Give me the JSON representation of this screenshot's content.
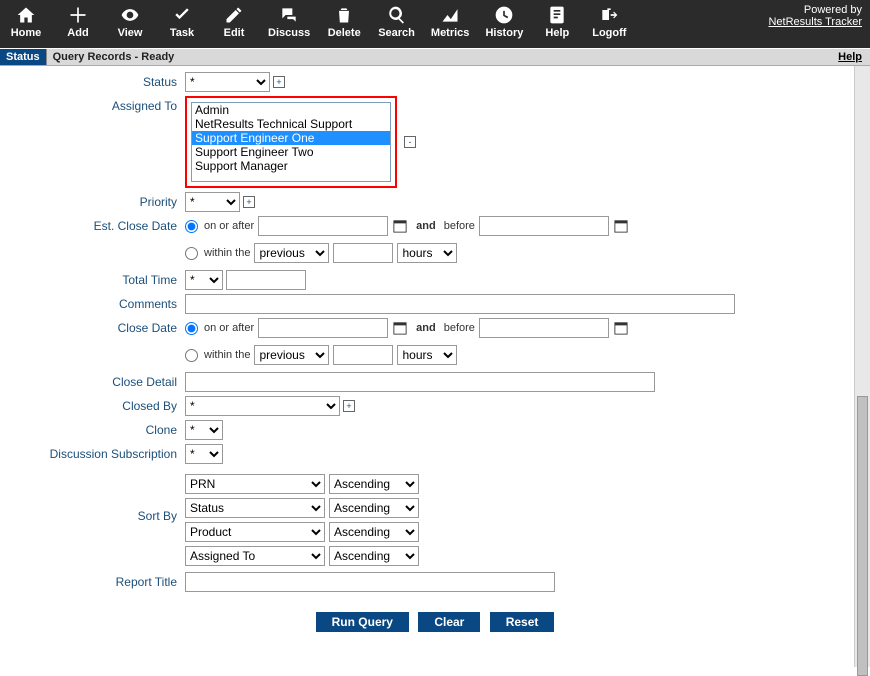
{
  "powered": {
    "text": "Powered by",
    "link": "NetResults Tracker"
  },
  "toolbar": [
    {
      "name": "home",
      "label": "Home"
    },
    {
      "name": "add",
      "label": "Add"
    },
    {
      "name": "view",
      "label": "View"
    },
    {
      "name": "task",
      "label": "Task"
    },
    {
      "name": "edit",
      "label": "Edit"
    },
    {
      "name": "discuss",
      "label": "Discuss"
    },
    {
      "name": "delete",
      "label": "Delete"
    },
    {
      "name": "search",
      "label": "Search"
    },
    {
      "name": "metrics",
      "label": "Metrics"
    },
    {
      "name": "history",
      "label": "History"
    },
    {
      "name": "help",
      "label": "Help"
    },
    {
      "name": "logoff",
      "label": "Logoff"
    }
  ],
  "statusbar": {
    "tab": "Status",
    "text": "Query Records - Ready",
    "help": "Help"
  },
  "labels": {
    "status": "Status",
    "assigned_to": "Assigned To",
    "priority": "Priority",
    "est_close_date": "Est. Close Date",
    "total_time": "Total Time",
    "comments": "Comments",
    "close_date": "Close Date",
    "close_detail": "Close Detail",
    "closed_by": "Closed By",
    "clone": "Clone",
    "discussion_sub": "Discussion Subscription",
    "sort_by": "Sort By",
    "report_title": "Report Title"
  },
  "values": {
    "status": "*",
    "priority": "*",
    "total_time_op": "*",
    "total_time_val": "",
    "comments": "",
    "close_detail": "",
    "closed_by": "*",
    "clone": "*",
    "discussion_sub": "*",
    "report_title": ""
  },
  "assigned_to": {
    "options": [
      "Admin",
      "NetResults Technical Support",
      "Support Engineer One",
      "Support Engineer Two",
      "Support Manager"
    ],
    "selected_index": 2
  },
  "date_block": {
    "radio_on_after": "on or after",
    "and_label": "and",
    "before": "before",
    "radio_within": "within the",
    "previous": "previous",
    "hours": "hours"
  },
  "sort": {
    "fields": [
      "PRN",
      "Status",
      "Product",
      "Assigned To"
    ],
    "orders": [
      "Ascending",
      "Ascending",
      "Ascending",
      "Ascending"
    ]
  },
  "buttons": {
    "run": "Run Query",
    "clear": "Clear",
    "reset": "Reset"
  },
  "icons": {
    "plus": "+",
    "minus": "-"
  }
}
